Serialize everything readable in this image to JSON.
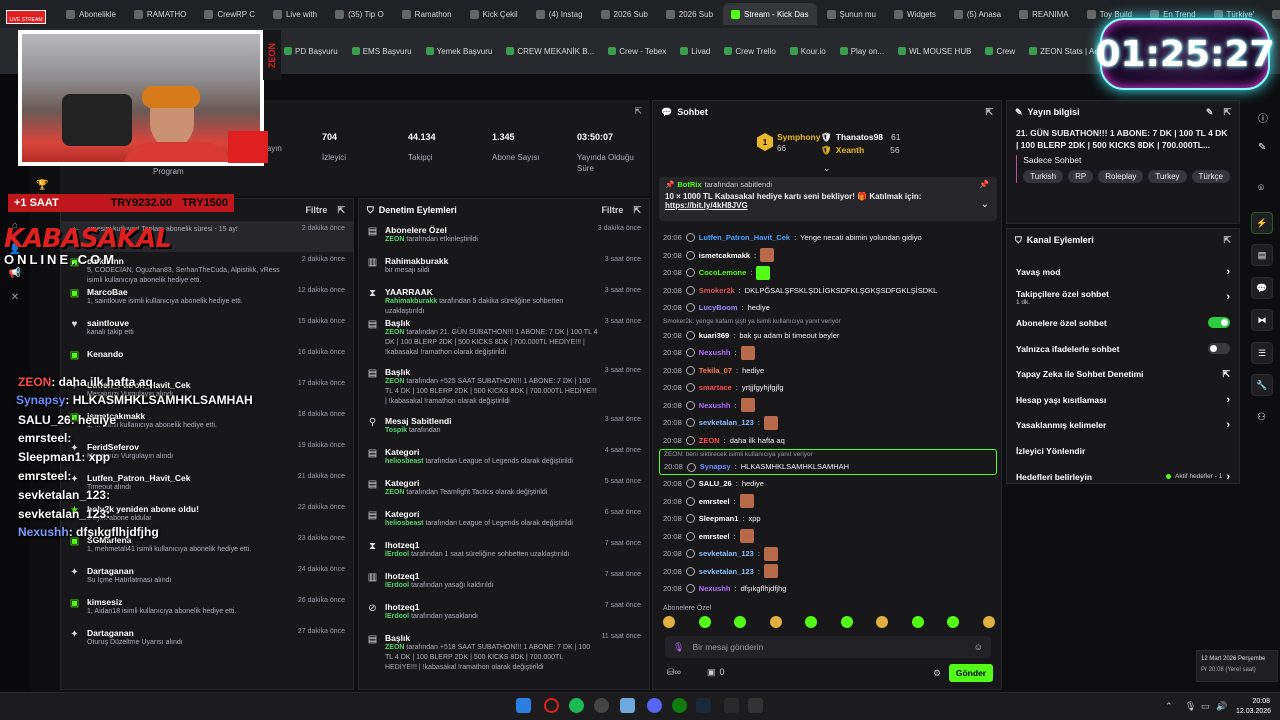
{
  "browser_tabs": [
    "Abonelikle",
    "RAMATHO",
    "CrewRP C",
    "Live with",
    "(35) Tip O",
    "Ramathon",
    "Kick Çekil",
    "(4) Instag",
    "2026 Sub",
    "2026 Sub",
    "Stream - Kick Das",
    "Şunun mu",
    "Widgets",
    "(5) Anasa",
    "REANIMA",
    "Toy Build",
    "En Trend",
    "Türkiye'",
    "Amazon"
  ],
  "active_tab_index": 10,
  "bookmarks": [
    "PD Başvuru",
    "EMS Başvuru",
    "Yemek Başvuru",
    "CREW MEKANİK B...",
    "Crew - Tebex",
    "Livad",
    "Crew Trello",
    "Kour.io",
    "Play on...",
    "WL MOUSE HUB",
    "Crew",
    "ZEON Stats | Aero...",
    "APIq"
  ],
  "timer": "01:25:27",
  "overlay": {
    "live_badge": "LIVE STREAM",
    "sub_banner": "+1 SAAT",
    "try_left": "TRY9232.00",
    "try_right": "TRY1500",
    "brand_top": "KABASAKAL",
    "brand_bottom": "ONLINE.COM",
    "webcam_brand": "ZEON",
    "chat": [
      {
        "user": "ZEON",
        "msg": ": daha ilk hafta aq",
        "color": "#ff4b4b"
      },
      {
        "user": "Synapsy",
        "msg": ": HLKASMHKLSAMHKLSAMHAH",
        "color": "#6e8cff"
      },
      {
        "user": "SALU_26",
        "msg": ": hediye",
        "color": "#ffffff"
      },
      {
        "user": "emrsteel",
        "msg": ":",
        "color": "#ffffff"
      },
      {
        "user": "Sleepman1",
        "msg": ": xpp",
        "color": "#ffffff"
      },
      {
        "user": "emrsteel",
        "msg": ":",
        "color": "#ffffff"
      },
      {
        "user": "sevketalan_123",
        "msg": ":",
        "color": "#ffffff"
      },
      {
        "user": "sevketalan_123",
        "msg": ":",
        "color": "#ffffff"
      },
      {
        "user": "Nexushh",
        "msg": ": dfşıkgflhjdfjhg",
        "color": "#7b9cff"
      }
    ]
  },
  "stats": [
    {
      "label": "Yayın",
      "value": ""
    },
    {
      "label": "İzleyici",
      "value": "704"
    },
    {
      "label": "Takipçi",
      "value": "44.134"
    },
    {
      "label": "Abone Sayısı",
      "value": "1.345"
    },
    {
      "label": "Yayında Olduğu Süre",
      "value": "03:50:07"
    }
  ],
  "program_label": "Program",
  "activity": {
    "filter_label": "Filtre",
    "header_partial": "Etkinlik Akışı",
    "items": [
      {
        "name": "",
        "sub": "emesini kutluyor! Toplam abonelik süresi - 15 ay!",
        "time": "2 dakika önce",
        "icon": "★"
      },
      {
        "name": "cmksknn",
        "sub": "5, CODECIAN, Oguzhan83, SerhanTheCuda, Alpistikk, vRess isimli kullanıcıya abonelik hediye etti.",
        "time": "2 dakika önce",
        "icon": "▣"
      },
      {
        "name": "MarcoBae",
        "sub": "1, saintlouve isimli kullanıcıya abonelik hediye etti.",
        "time": "12 dakika önce",
        "icon": "▣"
      },
      {
        "name": "saintlouve",
        "sub": "kanalı takip etti",
        "time": "15 dakika önce",
        "icon": "♥"
      },
      {
        "name": "Kenando",
        "sub": "",
        "time": "16 dakika önce",
        "icon": "▣"
      },
      {
        "name": "Lutfen_Patron_Havit_Cek",
        "sub": "Mesajınızı Vurgulayın alındı",
        "time": "17 dakika önce",
        "icon": "✦"
      },
      {
        "name": "ismetcakmakk",
        "sub": "1, ... isimli kullanıcıya abonelik hediye etti.",
        "time": "18 dakika önce",
        "icon": "▣"
      },
      {
        "name": "FeridSeferov",
        "sub": "Mesajınızı Vurgulayın alındı",
        "time": "19 dakika önce",
        "icon": "✦"
      },
      {
        "name": "Lutfen_Patron_Havit_Cek",
        "sub": "Timeout alındı",
        "time": "21 dakika önce",
        "icon": "✦"
      },
      {
        "name": "holy2k yeniden abone oldu!",
        "sub": "1 aylık abone oldular",
        "time": "22 dakika önce",
        "icon": "★"
      },
      {
        "name": "SGMarlena",
        "sub": "1, mehmetali41 isimli kullanıcıya abonelik hediye etti.",
        "time": "23 dakika önce",
        "icon": "▣"
      },
      {
        "name": "Dartaganan",
        "sub": "Su İçme Hatırlatması alındı",
        "time": "24 dakika önce",
        "icon": "✦"
      },
      {
        "name": "kimsesiz",
        "sub": "1, Aidan18 isimli kullanıcıya abonelik hediye etti.",
        "time": "26 dakika önce",
        "icon": "▣"
      },
      {
        "name": "Dartaganan",
        "sub": "Oturuş Düzeltme Uyarısı alındı",
        "time": "27 dakika önce",
        "icon": "✦"
      }
    ]
  },
  "moderation": {
    "title": "Denetim Eylemleri",
    "filter_label": "Filtre",
    "items": [
      {
        "name": "Abonelere Özel",
        "sub_user": "ZEON",
        "sub": " tarafından etkinleştirildi",
        "time": "3 dakika önce",
        "icon": "▤"
      },
      {
        "name": "Rahimakburakk",
        "sub_user": "",
        "sub": "bir mesajı sildi",
        "time": "3 saat önce",
        "icon": "▥"
      },
      {
        "name": "YAARRAAK",
        "sub_user": "Rahimakburakk",
        "sub": " tarafından 5 dakika süreliğine sohbetten uzaklaştırıldı",
        "time": "3 saat önce",
        "icon": "⧗"
      },
      {
        "name": "Başlık",
        "sub_user": "ZEON",
        "sub": " tarafından 21. GÜN SUBATHON!!! 1 ABONE: 7 DK | 100 TL 4 DK | 100 BLERP 2DK | 500 KICKS 8DK | 700.000TL HEDİYE!!! | !kabasakal !ramathon olarak değiştirildi",
        "time": "3 saat önce",
        "icon": "▤"
      },
      {
        "name": "Başlık",
        "sub_user": "ZEON",
        "sub": " tarafından +525 SAAT SUBATHON!!! 1 ABONE: 7 DK | 100 TL 4 DK | 100 BLERP 2DK | 500 KICKS 8DK | 700.000TL HEDİYE!!! | !kabasakal !ramathon olarak değiştirildi",
        "time": "3 saat önce",
        "icon": "▤"
      },
      {
        "name": "Mesaj Sabitlendi",
        "sub_user": "Tospik",
        "sub": " tarafından",
        "time": "3 saat önce",
        "icon": "⚲"
      },
      {
        "name": "Kategori",
        "sub_user": "heliosbeast",
        "sub": " tarafından League of Legends olarak değiştirildi",
        "time": "4 saat önce",
        "icon": "▤"
      },
      {
        "name": "Kategori",
        "sub_user": "ZEON",
        "sub": " tarafından Teamfight Tactics olarak değiştirildi",
        "time": "5 saat önce",
        "icon": "▤"
      },
      {
        "name": "Kategori",
        "sub_user": "heliosbeast",
        "sub": " tarafından League of Legends olarak değiştirildi",
        "time": "6 saat önce",
        "icon": "▤"
      },
      {
        "name": "lhotzeq1",
        "sub_user": "lErdool",
        "sub": " tarafından 1 saat süreliğine sohbetten uzaklaştırıldı",
        "time": "7 saat önce",
        "icon": "⧗"
      },
      {
        "name": "lhotzeq1",
        "sub_user": "lErdool",
        "sub": " tarafından yasağı kaldırıldı",
        "time": "7 saat önce",
        "icon": "▥"
      },
      {
        "name": "lhotzeq1",
        "sub_user": "lErdool",
        "sub": " tarafından yasaklandı",
        "time": "7 saat önce",
        "icon": "⊘"
      },
      {
        "name": "Başlık",
        "sub_user": "ZEON",
        "sub": " tarafından +518 SAAT SUBATHON!!! 1 ABONE: 7 DK | 100 TL 4 DK | 100 BLERP 2DK | 500 KICKS 8DK | 700.000TL HEDİYE!!! | !kabasakal !ramathon olarak değiştirildi",
        "time": "11 saat önce",
        "icon": "▤"
      }
    ]
  },
  "chat_panel": {
    "title": "Sohbet",
    "leaderboard": [
      {
        "name": "Symphony",
        "value": "66",
        "rank": "1"
      },
      {
        "name": "Thanatos98",
        "value": "61"
      },
      {
        "name": "Xeanth",
        "value": "56"
      }
    ],
    "pinned": {
      "user": "BotRix",
      "pinned_by": " tarafından sabitlendi",
      "text": "10 × 1000 TL Kabasakal hediye kartı seni bekliyor! 🎁 Katılmak için:",
      "link": "https://bit.ly/4kH8JVG"
    },
    "messages": [
      {
        "time": "20:06",
        "user": "Lutfen_Patron_Havit_Cek",
        "msg": "Yenge necati abimin yolundan gidiyo",
        "color": "#4aa3ff",
        "emote": false
      },
      {
        "time": "20:08",
        "user": "ismetcakmakk",
        "msg": "",
        "color": "#ffffff",
        "emote": true
      },
      {
        "time": "20:08",
        "user": "CocoLemone",
        "msg": "",
        "color": "#53fc18",
        "emote": true
      },
      {
        "time": "20:08",
        "user": "Smoker2k",
        "msg": "DKLPĞSALŞFSKLŞDLİGKSDFKLŞGKŞSDFGKLŞİSDKL",
        "color": "#e35050",
        "emote": false
      },
      {
        "time": "20:08",
        "user": "LucyBoom",
        "msg": "hediye",
        "color": "#9b8cff",
        "emote": false
      },
      {
        "time": "20:08",
        "user": "kuari369",
        "msg": "bak şu adam bi timeout beyler",
        "color": "#ffffff",
        "emote": false,
        "reply": "Smoker2k: yenge kafam şişti ya isimli kullanıcıya yanıt veriyor"
      },
      {
        "time": "20:08",
        "user": "Nexushh",
        "msg": "",
        "color": "#b46cff",
        "emote": true
      },
      {
        "time": "20:08",
        "user": "Tekila_07",
        "msg": "hediye",
        "color": "#ff7b4a",
        "emote": false
      },
      {
        "time": "20:08",
        "user": "smartace",
        "msg": "yrtjjfgyhjfgjfg",
        "color": "#ff4b4b",
        "emote": false
      },
      {
        "time": "20:08",
        "user": "Nexushh",
        "msg": "",
        "color": "#b46cff",
        "emote": true
      },
      {
        "time": "20:08",
        "user": "sevketalan_123",
        "msg": "",
        "color": "#8cbcff",
        "emote": true
      },
      {
        "time": "20:08",
        "user": "ZEON",
        "msg": "daha ilk hafta aq",
        "color": "#ff4b4b",
        "emote": false
      },
      {
        "time": "20:08",
        "user": "Synapsy",
        "msg": "HLKASMHKLSAMHKLSAMHAH",
        "color": "#6e8cff",
        "emote": false,
        "reply": "ZEON: beni siktirecek isimli kullanıcıya yanıt veriyor",
        "highlight": true
      },
      {
        "time": "20:08",
        "user": "SALU_26",
        "msg": "hediye",
        "color": "#ffffff",
        "emote": false
      },
      {
        "time": "20:08",
        "user": "emrsteel",
        "msg": "",
        "color": "#ffffff",
        "emote": true
      },
      {
        "time": "20:08",
        "user": "Sleepman1",
        "msg": "xpp",
        "color": "#ffffff",
        "emote": false
      },
      {
        "time": "20:08",
        "user": "emrsteel",
        "msg": "",
        "color": "#ffffff",
        "emote": true
      },
      {
        "time": "20:08",
        "user": "sevketalan_123",
        "msg": "",
        "color": "#8cbcff",
        "emote": true
      },
      {
        "time": "20:08",
        "user": "sevketalan_123",
        "msg": "",
        "color": "#8cbcff",
        "emote": true
      },
      {
        "time": "20:08",
        "user": "Nexushh",
        "msg": "dfşıkgflhjdfjhg",
        "color": "#b46cff",
        "emote": false
      }
    ],
    "mode_label": "Abonelere Özel",
    "input_placeholder": "Bir mesaj gönderin",
    "points": "0",
    "send_label": "Gönder"
  },
  "stream_info": {
    "title": "Yayın bilgisi",
    "stream_title": "21. GÜN SUBATHON!!! 1 ABONE: 7 DK | 100 TL 4 DK | 100 BLERP 2DK | 500 KICKS 8DK | 700.000TL...",
    "category": "Sadece Sohbet",
    "tags": [
      "Turkish",
      "RP",
      "Roleplay",
      "Turkey",
      "Türkçe"
    ]
  },
  "channel_actions": {
    "title": "Kanal Eylemleri",
    "items": [
      {
        "label": "Yavaş mod",
        "control": "chevron",
        "extra": ""
      },
      {
        "label": "Takipçilere özel sohbet",
        "control": "chevron",
        "extra": "1 dk."
      },
      {
        "label": "Abonelere özel sohbet",
        "control": "toggle-on",
        "extra": ""
      },
      {
        "label": "Yalnızca ifadelerle sohbet",
        "control": "toggle-off",
        "extra": ""
      },
      {
        "label": "Yapay Zeka ile Sohbet Denetimi",
        "control": "external",
        "extra": ""
      },
      {
        "label": "Hesap yaşı kısıtlaması",
        "control": "chevron",
        "extra": ""
      },
      {
        "label": "Yasaklanmış kelimeler",
        "control": "chevron",
        "extra": ""
      },
      {
        "label": "İzleyici Yönlendir",
        "control": "none",
        "extra": ""
      },
      {
        "label": "Hedefleri belirleyin",
        "control": "chevron",
        "extra": "Aktif hedefler - 1"
      }
    ]
  },
  "clock": {
    "date_tooltip": "12 Mart 2026 Perşembe",
    "local_time": "Pr 20:08 (Yerel saat)",
    "time": "20:08",
    "date": "12.03.2026"
  },
  "colors": {
    "accent": "#53fc18",
    "bg": "#0e0e10",
    "panel": "#18181b"
  }
}
